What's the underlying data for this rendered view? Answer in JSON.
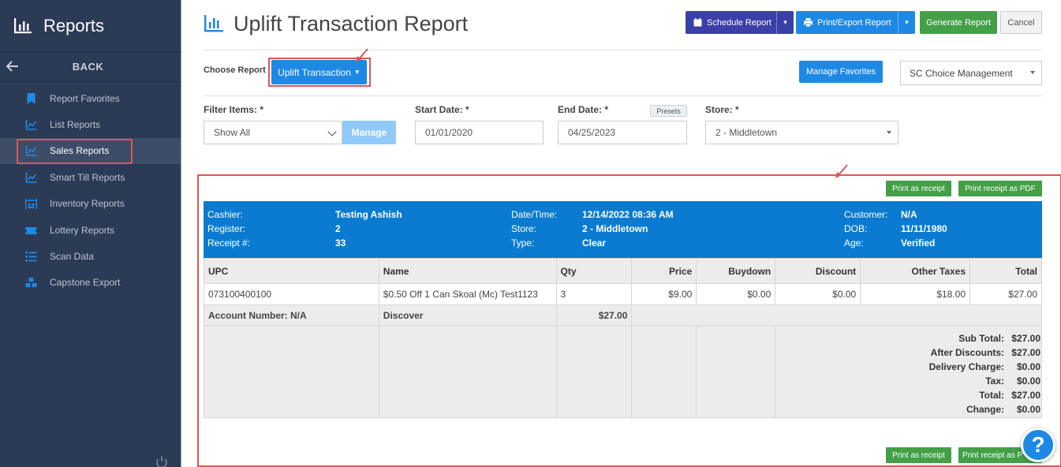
{
  "sidebar": {
    "title": "Reports",
    "back_label": "BACK",
    "items": [
      {
        "label": "Report Favorites",
        "icon": "bookmark-icon"
      },
      {
        "label": "List Reports",
        "icon": "chart-line-icon"
      },
      {
        "label": "Sales Reports",
        "icon": "chart-line-icon",
        "active": true
      },
      {
        "label": "Smart Till Reports",
        "icon": "chart-line-icon"
      },
      {
        "label": "Inventory Reports",
        "icon": "warehouse-icon"
      },
      {
        "label": "Lottery Reports",
        "icon": "ticket-icon"
      },
      {
        "label": "Scan Data",
        "icon": "list-icon"
      },
      {
        "label": "Capstone Export",
        "icon": "cubes-icon"
      }
    ]
  },
  "header": {
    "title": "Uplift Transaction Report",
    "schedule_label": "Schedule Report",
    "print_label": "Print/Export Report",
    "generate_label": "Generate Report",
    "cancel_label": "Cancel"
  },
  "choose": {
    "label": "Choose Report",
    "selected": "Uplift Transaction",
    "favorites_label": "Manage Favorites",
    "company": "SC Choice Management"
  },
  "filters": {
    "filter_items_label": "Filter Items: *",
    "filter_items_value": "Show All",
    "manage_label": "Manage",
    "start_label": "Start Date: *",
    "start_value": "01/01/2020",
    "end_label": "End Date: *",
    "end_value": "04/25/2023",
    "presets_label": "Presets",
    "store_label": "Store: *",
    "store_value": "2 - Middletown"
  },
  "receipt": {
    "print_label": "Print as receipt",
    "pdf_label": "Print receipt as PDF",
    "pdf_label_bottom": "Print receipt as P",
    "info": {
      "cashier_label": "Cashier:",
      "cashier": "Testing Ashish",
      "register_label": "Register:",
      "register": "2",
      "receipt_label": "Receipt #:",
      "receipt": "33",
      "datetime_label": "Date/Time:",
      "datetime": "12/14/2022 08:36 AM",
      "store_label": "Store:",
      "store": "2 - Middletown",
      "type_label": "Type:",
      "type": "Clear",
      "customer_label": "Customer:",
      "customer": "N/A",
      "dob_label": "DOB:",
      "dob": "11/11/1980",
      "age_label": "Age:",
      "age": "Verified"
    },
    "columns": [
      "UPC",
      "Name",
      "Qty",
      "Price",
      "Buydown",
      "Discount",
      "Other Taxes",
      "Total"
    ],
    "rows": [
      {
        "upc": "073100400100",
        "name": "$0.50 Off 1 Can Skoal (Mc) Test1123",
        "qty": "3",
        "price": "$9.00",
        "buydown": "$0.00",
        "discount": "$0.00",
        "other_taxes": "$18.00",
        "total": "$27.00"
      }
    ],
    "account": {
      "label": "Account Number: N/A",
      "method": "Discover",
      "amount": "$27.00"
    },
    "totals": [
      {
        "label": "Sub Total:",
        "value": "$27.00"
      },
      {
        "label": "After Discounts:",
        "value": "$27.00"
      },
      {
        "label": "Delivery Charge:",
        "value": "$0.00"
      },
      {
        "label": "Tax:",
        "value": "$0.00"
      },
      {
        "label": "Total:",
        "value": "$27.00"
      },
      {
        "label": "Change:",
        "value": "$0.00"
      }
    ]
  },
  "help_label": "?",
  "colors": {
    "sidebar": "#2c3b55",
    "primary": "#1e88e5",
    "schedule": "#3b3fa8",
    "success": "#43a047",
    "receipt_header": "#0a7bd0",
    "highlight": "#e05555"
  }
}
